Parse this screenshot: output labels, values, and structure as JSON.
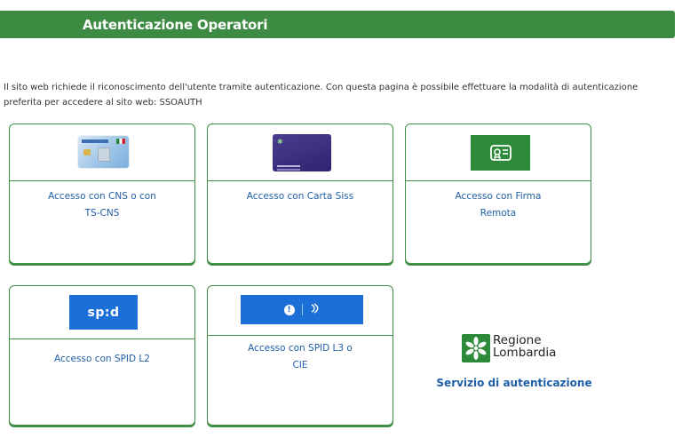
{
  "header": {
    "title": "Autenticazione Operatori"
  },
  "intro": {
    "text": "Il sito web richiede il riconoscimento dell'utente tramite autenticazione. Con questa pagina è possibile effettuare la modalità di autenticazione preferita per accedere al sito web: SSOAUTH"
  },
  "cards": [
    {
      "line1": "Accesso con CNS o con",
      "line2": "TS-CNS",
      "icon": "cns-card-icon"
    },
    {
      "line1": "Accesso con Carta Siss",
      "line2": "",
      "icon": "carta-siss-card-icon"
    },
    {
      "line1": "Accesso con Firma",
      "line2": "Remota",
      "icon": "certificate-icon"
    },
    {
      "line1": "Accesso con SPID L2",
      "line2": "",
      "icon": "spid-logo",
      "logo_text": "sp:d"
    },
    {
      "line1": "Accesso con SPID L3 o",
      "line2": "CIE",
      "icon": "spid-cie-logo"
    }
  ],
  "brand": {
    "name_line1": "Regione",
    "name_line2": "Lombardia",
    "service": "Servizio di autenticazione"
  },
  "colors": {
    "header_green": "#3d8a42",
    "card_border": "#3f8f44",
    "link_blue": "#1f5fa8",
    "spid_blue": "#1b6fd6"
  }
}
